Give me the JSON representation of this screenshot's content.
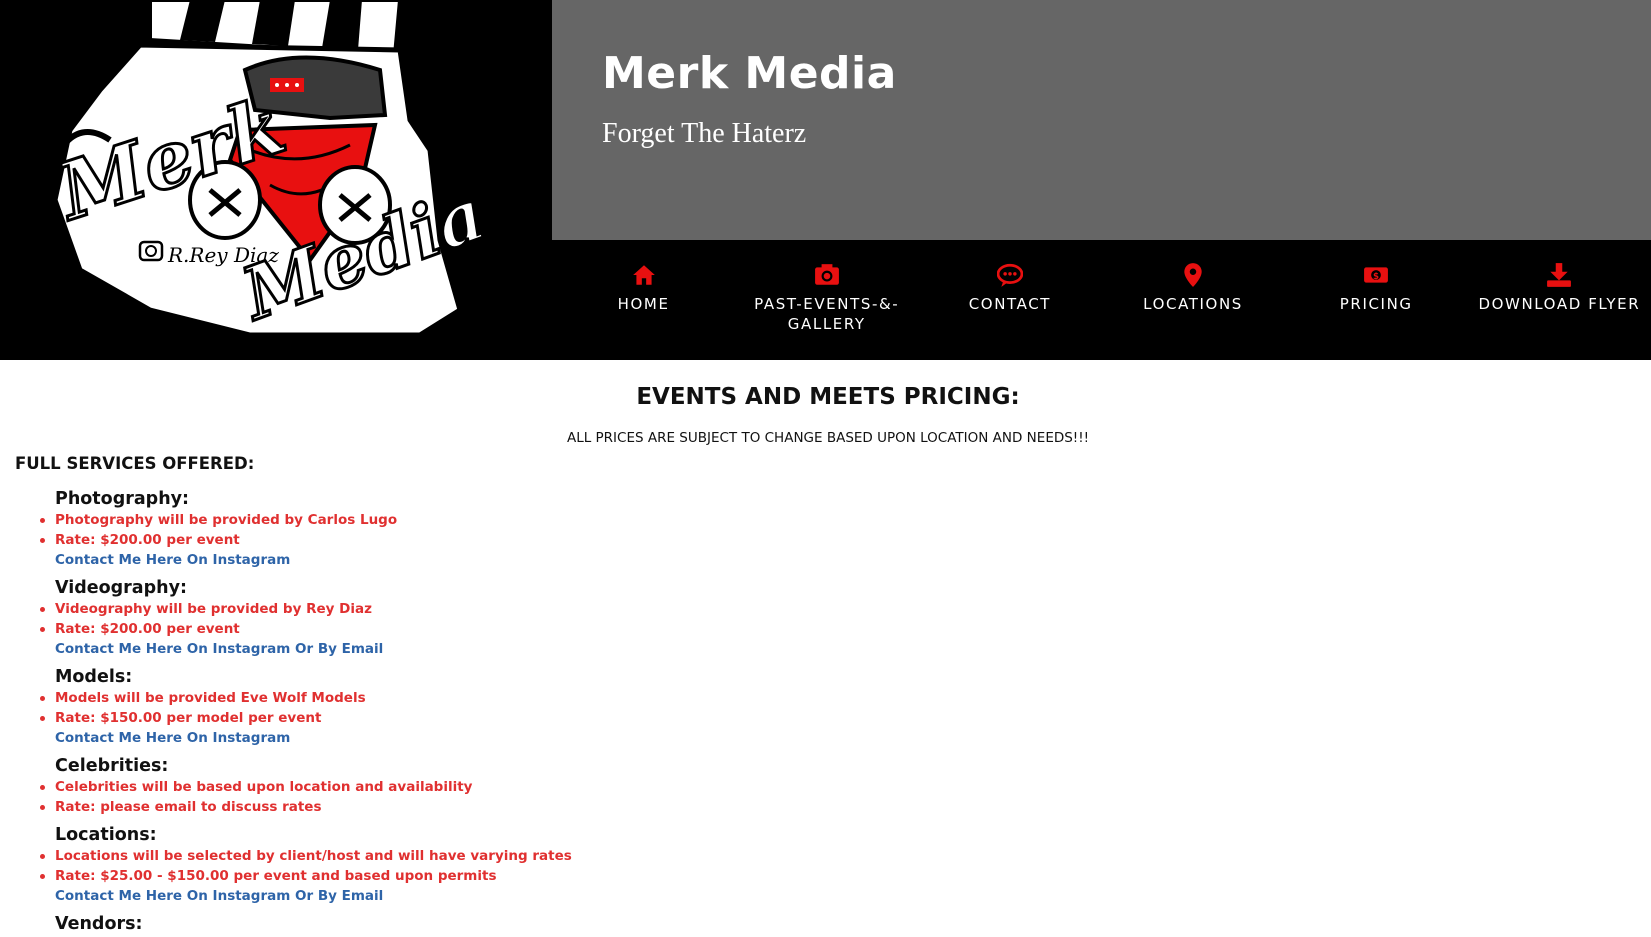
{
  "header": {
    "title": "Merk Media",
    "tagline": "Forget The Haterz",
    "logo_text": "Merk Media",
    "logo_signature": "R.Rey Diaz"
  },
  "nav": {
    "items": [
      {
        "label": "HOME",
        "icon": "home-icon"
      },
      {
        "label": "PAST-EVENTS-&-\nGALLERY",
        "icon": "camera-icon"
      },
      {
        "label": "CONTACT",
        "icon": "chat-icon"
      },
      {
        "label": "LOCATIONS",
        "icon": "map-pin-icon"
      },
      {
        "label": "PRICING",
        "icon": "money-icon"
      },
      {
        "label": "DOWNLOAD FLYER",
        "icon": "download-icon"
      }
    ]
  },
  "main": {
    "heading": "EVENTS AND MEETS PRICING:",
    "notice": "ALL PRICES ARE SUBJECT TO CHANGE BASED UPON LOCATION AND NEEDS!!!",
    "services_heading": "FULL SERVICES OFFERED:",
    "services": [
      {
        "title": "Photography:",
        "items": [
          "Photography will be provided by Carlos Lugo",
          "Rate: $200.00 per event"
        ],
        "link": "Contact Me Here On Instagram"
      },
      {
        "title": "Videography:",
        "items": [
          "Videography will be provided by Rey Diaz",
          "Rate: $200.00 per event"
        ],
        "link": "Contact Me Here On Instagram Or By Email"
      },
      {
        "title": "Models:",
        "items": [
          "Models will be provided Eve Wolf Models",
          "Rate: $150.00 per model per event"
        ],
        "link": "Contact Me Here On Instagram"
      },
      {
        "title": "Celebrities:",
        "items": [
          "Celebrities will be based upon location and availability",
          "Rate: please email to discuss rates"
        ],
        "link": ""
      },
      {
        "title": "Locations:",
        "items": [
          "Locations will be selected by client/host and will have varying rates",
          "Rate: $25.00 - $150.00 per event and based upon permits"
        ],
        "link": "Contact Me Here On Instagram Or By Email"
      },
      {
        "title": "Vendors:",
        "items": [],
        "link": ""
      }
    ]
  },
  "colors": {
    "accent": "#e81010",
    "title_bg": "#666666",
    "nav_bg": "#000000",
    "bullet_text": "#e03030",
    "link": "#2e64a8"
  }
}
